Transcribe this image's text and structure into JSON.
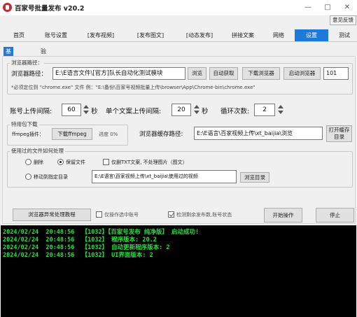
{
  "app": {
    "title": "百家号批量发布  v20.2",
    "feedback": "意见反馈",
    "minimize": "—",
    "maximize": "□",
    "close": "✕"
  },
  "tabs": [
    "首页",
    "账号设置",
    "[发布视频]",
    "[发布图文]",
    "[动态发布]",
    "拼接文案",
    "网络",
    "设置",
    "测试"
  ],
  "active_tab": "设置",
  "subtabs": [
    "基本设置",
    "验证"
  ],
  "browser": {
    "group_label": "浏览器路径：",
    "path_label": "浏览器路径：",
    "path_value": "E:\\E语言文件\\[官方]队长自动化测试模块",
    "btn_browse": "浏览",
    "btn_auto": "自动获取",
    "btn_download": "下载浏览器",
    "btn_start": "启动浏览器",
    "port": "101",
    "hint": "*必须定位到 \"chrome.exe\" 文件          例：\"E:\\备份\\百家号视频批量上传\\browser\\App\\Chrome-bin\\chrome.exe\""
  },
  "intervals": {
    "account_label": "账号上传间隔:",
    "account_value": "60",
    "account_unit": "秒",
    "single_label": "单个文案上传间隔:",
    "single_value": "20",
    "single_unit": "秒",
    "loop_label": "循环次数:",
    "loop_value": "2"
  },
  "package": {
    "group_label": "特用包下载",
    "ffmpeg_label": "ffmpeg插件：",
    "btn_ffmpeg": "下载ffmpeg",
    "progress_label": "进度 0%",
    "cache_label": "浏览器缓存路径:",
    "cache_value": "E:\\E语言\\百家视频上传\\xt_baijia\\浏览",
    "btn_open_cache": "打开缓存\n目录"
  },
  "used_files": {
    "group_label": "使用过的文件如何处理",
    "opt_delete": "删除",
    "opt_keep": "保留文件",
    "opt_txt_only": "仅删TXT文案, 不处理图片（图文）",
    "opt_move": "移动到指定目录",
    "move_path": "E:\\E语言\\百家视频上传\\xt_baijia\\使用过的视频",
    "btn_browse_dir": "浏览目录"
  },
  "bottom": {
    "btn_exception": "浏览器异常处理教程",
    "only_selected": "仅操作选中账号",
    "detect_remaining": "检测剩余发布数,账号状态",
    "btn_start": "开始操作",
    "btn_stop": "停止"
  },
  "log": [
    "2024/02/24  20:48:56  【1032】【百家号发布 纯净版】 启动成功!",
    "2024/02/24  20:48:56  【1032】 程序版本: 20.2",
    "2024/02/24  20:48:56  【1032】 自动更新程序版本: 2",
    "2024/02/24  20:48:56  【1032】 UI界面版本: 2"
  ],
  "colors": {
    "accent": "#1e7ad8",
    "console_bg": "#000000",
    "console_text": "#21e33a"
  },
  "state": {
    "radio_keep": true,
    "radio_move": false,
    "check_txt_only": false,
    "check_only_selected": false,
    "check_detect_remaining": true
  }
}
